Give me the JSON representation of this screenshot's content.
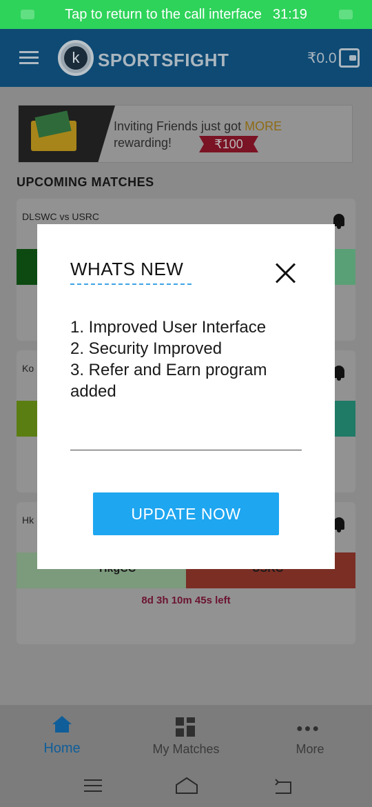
{
  "call_bar": {
    "text": "Tap to return to the call interface",
    "time": "31:19"
  },
  "header": {
    "logo_letter": "k",
    "app_name": "SPORTSFIGHT",
    "wallet_balance": "₹0.0"
  },
  "banner": {
    "text_line1": "Inviting Friends just got ",
    "text_highlight": "MORE",
    "text_line2": "rewarding!",
    "amount": "₹100"
  },
  "section_title": "UPCOMING MATCHES",
  "matches": [
    {
      "title": "DLSWC vs USRC"
    },
    {
      "title": "Ko"
    },
    {
      "title": "Hk",
      "team_left": "HkgCC",
      "team_right": "USRC",
      "time_left": "8d 3h 10m 45s left"
    }
  ],
  "modal": {
    "title": "WHATS NEW",
    "notes": [
      "1. Improved User Interface",
      "2. Security Improved",
      "3. Refer and Earn program added"
    ],
    "button_label": "UPDATE NOW"
  },
  "bottom_nav": [
    {
      "label": "Home",
      "icon": "home-icon",
      "active": true
    },
    {
      "label": "My Matches",
      "icon": "grid-icon",
      "active": false
    },
    {
      "label": "More",
      "icon": "more-dots-icon",
      "active": false
    }
  ],
  "colors": {
    "accent": "#1ea6f0",
    "header": "#0e4a74",
    "call_bar": "#2ed35a",
    "active_nav": "#0f5e9a"
  }
}
